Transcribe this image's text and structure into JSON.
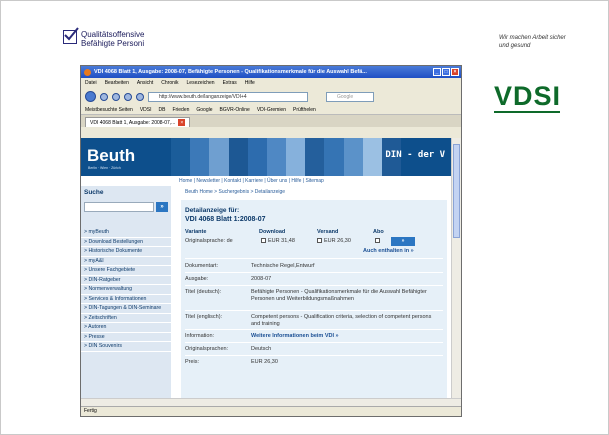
{
  "slide": {
    "logo_text_line1": "Qualitätsoffensive",
    "logo_text_line2": "Befähigte Personi",
    "tagline_line1": "Wir machen Arbeit sicher",
    "tagline_line2": "und gesund",
    "vdsi_logo": "VDSI"
  },
  "browser": {
    "title": "VDI 4068 Blatt 1, Ausgabe: 2008-07, Befähigte Personen - Qualifikationsmerkmale für die Auswahl Befä...",
    "menu": [
      "Datei",
      "Bearbeiten",
      "Ansicht",
      "Chronik",
      "Lesezeichen",
      "Extras",
      "Hilfe"
    ],
    "url": "http://www.beuth.de/langanzeige/VDI+4",
    "search_placeholder": "Google",
    "bookmarks": [
      "Meistbesuchte Seiten",
      "VDSI",
      "DB",
      "Frieden",
      "Google",
      "BGVR-Online",
      "VDI-Gremien",
      "Prüfthelen"
    ],
    "tab_label": "VDI 4068 Blatt 1, Ausgabe: 2008-07,...",
    "status": "Fertig"
  },
  "page": {
    "brand": "Beuth",
    "brand_sub": "Berlin · Wien · Zürich",
    "banner_right": "DIN - der V",
    "topnav": "Home | Newsletter | Kontakt | Karriere | Über uns | Hilfe | Sitemap",
    "suche_title": "Suche",
    "suche_go": "»",
    "leftnav": [
      "> myBeuth",
      "> Download Bestellungen",
      "> Historische Dokumente",
      "> myA&I",
      "> Unsere Fachgebiete",
      "> DIN-Ratgeber",
      "> Normenverwaltung",
      "> Services & Informationen",
      "> DIN-Tagungen & DIN-Seminare",
      "> Zeitschriften",
      "> Autoren",
      "> Presse",
      "> DIN Souvenirs"
    ],
    "breadcrumb": "Beuth Home > Suchergebnis > Detailanzeige",
    "detail_title": "Detailanzeige für:",
    "detail_doc": "VDI 4068 Blatt 1:2008-07",
    "col_variante": "Variante",
    "col_download": "Download",
    "col_versand": "Versand",
    "col_abo": "Abo",
    "variant_label": "Originalsprache: de",
    "download_price": "EUR 31,48",
    "versand_price": "EUR 26,30",
    "add_button": "»",
    "auch_enthalten": "Auch enthalten in »",
    "fields": [
      {
        "label": "Dokumentart:",
        "value": "Technische Regel,Entwurf"
      },
      {
        "label": "Ausgabe:",
        "value": "2008-07"
      },
      {
        "label": "Titel (deutsch):",
        "value": "Befähigte Personen - Qualifikationsmerkmale für die Auswahl Befähigter Personen und Weiterbildungsmaßnahmen"
      },
      {
        "label": "Titel (englisch):",
        "value": "Competent persons - Qualification criteria, selection of competent persons and training"
      },
      {
        "label": "Information:",
        "value": "Weitere Informationen beim VDI »"
      },
      {
        "label": "Originalsprachen:",
        "value": "Deutsch"
      },
      {
        "label": "Preis:",
        "value": "EUR 26,30"
      }
    ]
  },
  "colors": {
    "beuth_blue": "#0d4f8c",
    "vdsi_green": "#0e6a2a",
    "firefox_title": "#1f4fc4"
  }
}
